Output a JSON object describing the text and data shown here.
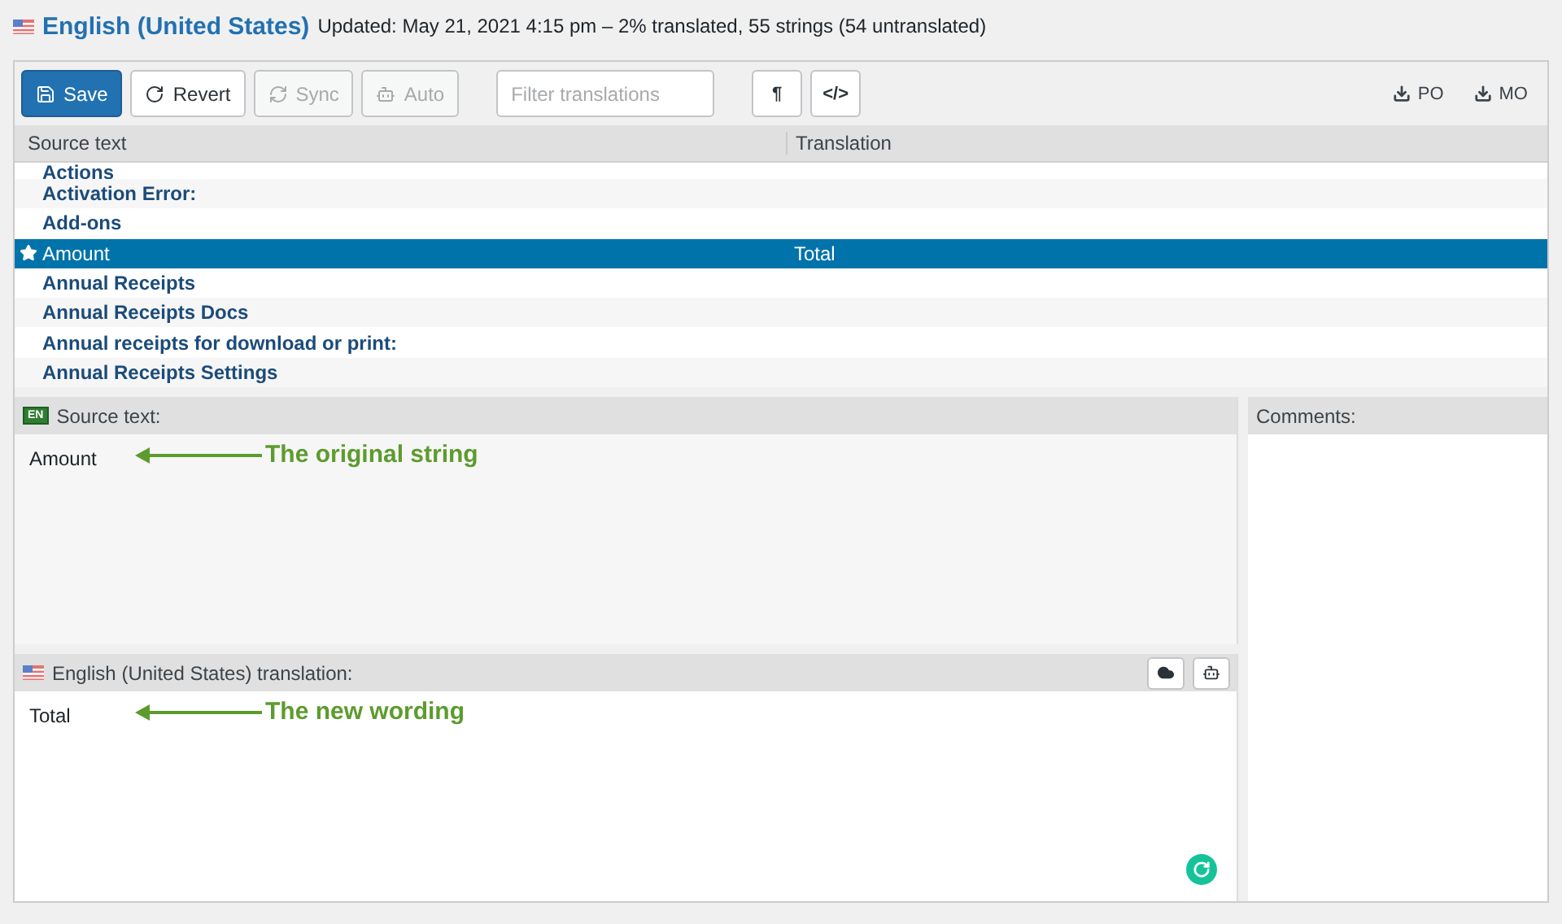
{
  "header": {
    "locale": "English (United States)",
    "meta": "Updated: May 21, 2021 4:15 pm – 2% translated, 55 strings (54 untranslated)"
  },
  "toolbar": {
    "buttons": [
      {
        "kind": "save",
        "label": "Save",
        "primary": true,
        "disabled": false
      },
      {
        "kind": "revert",
        "label": "Revert",
        "primary": false,
        "disabled": false
      },
      {
        "kind": "sync",
        "label": "Sync",
        "primary": false,
        "disabled": true
      },
      {
        "kind": "auto",
        "label": "Auto",
        "primary": false,
        "disabled": true
      }
    ],
    "filter": {
      "placeholder": "Filter translations"
    },
    "toggles": [
      "¶",
      "</>"
    ],
    "downloads": [
      "PO",
      "MO"
    ]
  },
  "table": {
    "columns": [
      "Source text",
      "Translation"
    ],
    "rows": [
      {
        "source": "Actions",
        "translation": "",
        "selected": false
      },
      {
        "source": "Activation Error:",
        "translation": "",
        "selected": false
      },
      {
        "source": "Add-ons",
        "translation": "",
        "selected": false
      },
      {
        "source": "Amount",
        "translation": "Total",
        "selected": true
      },
      {
        "source": "Annual Receipts",
        "translation": "",
        "selected": false
      },
      {
        "source": "Annual Receipts Docs",
        "translation": "",
        "selected": false
      },
      {
        "source": "Annual receipts for download or print:",
        "translation": "",
        "selected": false
      },
      {
        "source": "Annual Receipts Settings",
        "translation": "",
        "selected": false
      }
    ]
  },
  "source_panel": {
    "badge": "EN",
    "title": "Source text:",
    "value": "Amount",
    "annotation": "The original string"
  },
  "translation_panel": {
    "title": "English (United States) translation:",
    "value": "Total",
    "annotation": "The new wording"
  },
  "comments_panel": {
    "title": "Comments:"
  }
}
